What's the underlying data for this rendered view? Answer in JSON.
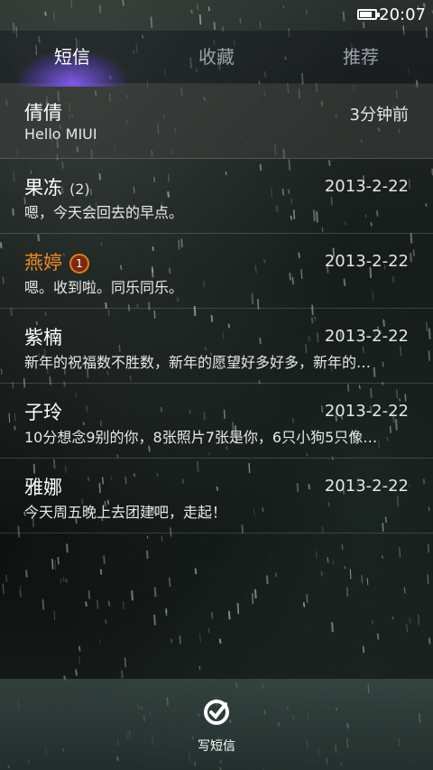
{
  "status_bar": {
    "time": "20:07",
    "battery_level": 0.8
  },
  "tabs": [
    {
      "label": "短信",
      "active": true
    },
    {
      "label": "收藏",
      "active": false
    },
    {
      "label": "推荐",
      "active": false
    }
  ],
  "conversations": [
    {
      "name": "倩倩",
      "count": "",
      "unread_badge": "",
      "time": "3分钟前",
      "preview": "Hello MIUI"
    },
    {
      "name": "果冻",
      "count": "(2)",
      "unread_badge": "",
      "time": "2013-2-22",
      "preview": "嗯，今天会回去的早点。"
    },
    {
      "name": "燕婷",
      "count": "",
      "unread_badge": "1",
      "time": "2013-2-22",
      "preview": "嗯。收到啦。同乐同乐。"
    },
    {
      "name": "紫楠",
      "count": "",
      "unread_badge": "",
      "time": "2013-2-22",
      "preview": "新年的祝福数不胜数，新年的愿望好多好多，新年的…"
    },
    {
      "name": "子玲",
      "count": "",
      "unread_badge": "",
      "time": "2013-2-22",
      "preview": "10分想念9别的你，8张照片7张是你，6只小狗5只像…"
    },
    {
      "name": "雅娜",
      "count": "",
      "unread_badge": "",
      "time": "2013-2-22",
      "preview": "今天周五晚上去团建吧，走起！"
    }
  ],
  "compose": {
    "label": "写短信",
    "icon": "compose-icon"
  },
  "colors": {
    "unread_name": "#f08a25",
    "active_tab_glow": "#7a5af0"
  }
}
